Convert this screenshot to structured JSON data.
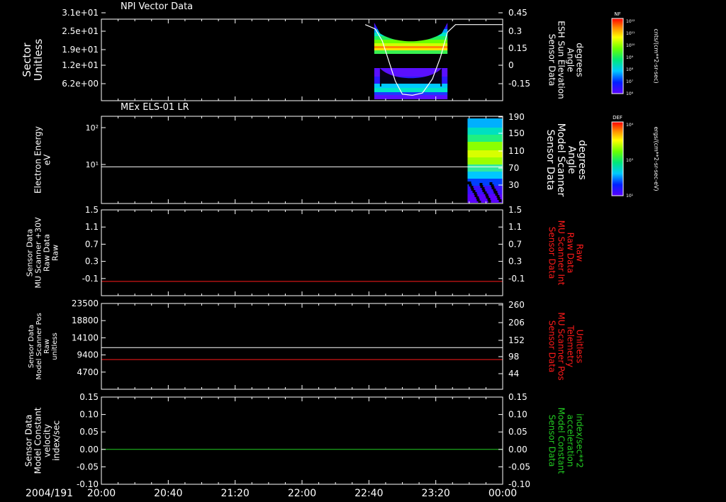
{
  "colors": {
    "background": "#000000",
    "axis": "#ffffff",
    "red": "#ff1a1a",
    "green": "#22cc22"
  },
  "chart_data": [
    {
      "type": "heatmap",
      "title": "NPI Vector Data",
      "ylabel": "Sector\nUnitless",
      "yticks": [
        "3.1e+01",
        "2.5e+01",
        "1.9e+01",
        "1.2e+01",
        "6.2e+00"
      ],
      "ylim": [
        0,
        31
      ],
      "y2label": "Sensor Data\nESH Sun Elevation\nAngle\ndegrees",
      "y2ticks": [
        0.45,
        0.3,
        0.15,
        0.0,
        -0.15
      ],
      "y2lim": [
        -0.3,
        0.45
      ],
      "data_extent_hours": [
        2.72,
        3.45
      ],
      "sun_elevation_curve": [
        {
          "t": 2.63,
          "v": 0.4
        },
        {
          "t": 2.73,
          "v": 0.36
        },
        {
          "t": 2.8,
          "v": 0.25
        },
        {
          "t": 2.87,
          "v": 0.05
        },
        {
          "t": 2.93,
          "v": -0.12
        },
        {
          "t": 3.0,
          "v": -0.24
        },
        {
          "t": 3.1,
          "v": -0.25
        },
        {
          "t": 3.2,
          "v": -0.23
        },
        {
          "t": 3.3,
          "v": -0.1
        },
        {
          "t": 3.38,
          "v": 0.1
        },
        {
          "t": 3.45,
          "v": 0.33
        },
        {
          "t": 3.53,
          "v": 0.4
        },
        {
          "t": 4.0,
          "v": 0.4
        }
      ],
      "colorbar": {
        "label": "NF",
        "units": "cnts/(cm**2-sr-sec)",
        "ticks": [
          "10¹²",
          "10¹¹",
          "10¹⁰",
          "10⁹",
          "10⁸",
          "10⁷",
          "10⁶"
        ]
      }
    },
    {
      "type": "heatmap",
      "title": "MEx ELS-01 LR",
      "ylabel": "Electron Energy\neV",
      "yscale": "log",
      "yticks": [
        "10²",
        "10¹"
      ],
      "y2label": "Sensor Data\nModel Scanner\nAngle\ndegrees",
      "y2ticks": [
        190,
        150,
        110,
        70,
        30
      ],
      "y2lim": [
        0,
        190
      ],
      "scanner_angle": [
        {
          "t": 0.0,
          "v": 80
        },
        {
          "t": 4.0,
          "v": 80
        }
      ],
      "data_extent_hours": [
        3.65,
        4.0
      ],
      "colorbar": {
        "label": "DEF",
        "units": "ergs/(cm**2-sr-sec-eV)",
        "ticks": [
          "10⁴",
          "10³",
          "10¹"
        ]
      }
    },
    {
      "type": "line",
      "ylabel": "Sensor Data\nMU Scanner +30V\nRaw Data\nRaw",
      "yticks": [
        1.5,
        1.1,
        0.7,
        0.3,
        -0.1
      ],
      "ylim": [
        -0.3,
        1.5
      ],
      "y2label": "Sensor Data\nMU Scanner Int\nRaw Data\nRaw",
      "y2ticks": [
        1.5,
        1.1,
        0.7,
        0.3,
        -0.1
      ],
      "series": [
        {
          "values_t": [
            0.0,
            4.0
          ],
          "values_v": [
            0.0,
            0.0
          ]
        }
      ]
    },
    {
      "type": "line",
      "ylabel": "Sensor Data\nModel Scanner Pos\nRaw\nunitless",
      "yticks": [
        23500,
        18800,
        14100,
        9400,
        4700
      ],
      "ylim": [
        0,
        23500
      ],
      "y2label": "Sensor Data\nMU Scanner Pos\nTelemetry\nUnitless",
      "y2ticks": [
        260,
        206,
        152,
        98,
        44
      ],
      "y2lim": [
        0,
        260
      ],
      "series": [
        {
          "values_t": [
            0.0,
            4.0
          ],
          "values_v": [
            11400,
            11400
          ]
        },
        {
          "values_t": [
            0.0,
            4.0
          ],
          "values_v": [
            90,
            90
          ]
        }
      ]
    },
    {
      "type": "line",
      "ylabel": "Sensor Data\nModel Constant\nvelocity\nindex/sec",
      "yticks": [
        "0.15",
        "0.10",
        "0.05",
        "0.00",
        "-0.05",
        "-0.10"
      ],
      "ylim": [
        -0.1,
        0.15
      ],
      "y2label": "Sensor Data\nModel Constant\nacceleration\nindex/sec**2",
      "y2ticks": [
        "0.15",
        "0.10",
        "0.05",
        "0.00",
        "-0.05",
        "-0.10"
      ],
      "series": [
        {
          "values_t": [
            0.0,
            4.0
          ],
          "values_v": [
            0.0,
            0.0
          ]
        }
      ]
    }
  ],
  "xaxis": {
    "date_label": "2004/191",
    "tick_labels": [
      "20:00",
      "20:40",
      "21:20",
      "22:00",
      "22:40",
      "23:20",
      "00:00"
    ],
    "range_hours": [
      0,
      4
    ]
  }
}
